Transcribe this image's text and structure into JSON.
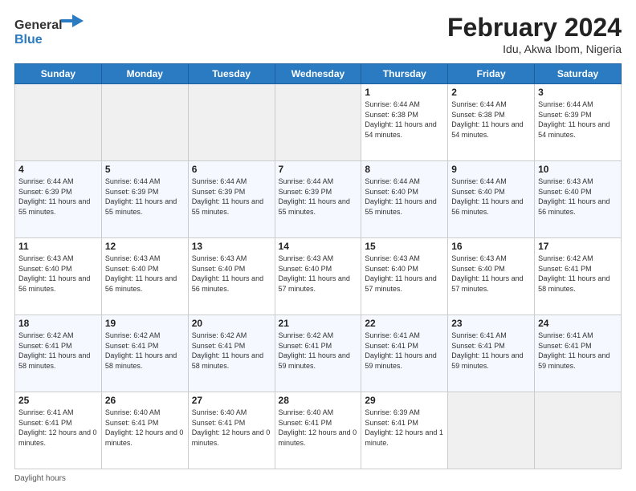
{
  "header": {
    "logo_general": "General",
    "logo_blue": "Blue",
    "month_year": "February 2024",
    "location": "Idu, Akwa Ibom, Nigeria"
  },
  "weekdays": [
    "Sunday",
    "Monday",
    "Tuesday",
    "Wednesday",
    "Thursday",
    "Friday",
    "Saturday"
  ],
  "weeks": [
    [
      {
        "day": "",
        "empty": true
      },
      {
        "day": "",
        "empty": true
      },
      {
        "day": "",
        "empty": true
      },
      {
        "day": "",
        "empty": true
      },
      {
        "day": "1",
        "sunrise": "6:44 AM",
        "sunset": "6:38 PM",
        "daylight": "11 hours and 54 minutes."
      },
      {
        "day": "2",
        "sunrise": "6:44 AM",
        "sunset": "6:38 PM",
        "daylight": "11 hours and 54 minutes."
      },
      {
        "day": "3",
        "sunrise": "6:44 AM",
        "sunset": "6:39 PM",
        "daylight": "11 hours and 54 minutes."
      }
    ],
    [
      {
        "day": "4",
        "sunrise": "6:44 AM",
        "sunset": "6:39 PM",
        "daylight": "11 hours and 55 minutes."
      },
      {
        "day": "5",
        "sunrise": "6:44 AM",
        "sunset": "6:39 PM",
        "daylight": "11 hours and 55 minutes."
      },
      {
        "day": "6",
        "sunrise": "6:44 AM",
        "sunset": "6:39 PM",
        "daylight": "11 hours and 55 minutes."
      },
      {
        "day": "7",
        "sunrise": "6:44 AM",
        "sunset": "6:39 PM",
        "daylight": "11 hours and 55 minutes."
      },
      {
        "day": "8",
        "sunrise": "6:44 AM",
        "sunset": "6:40 PM",
        "daylight": "11 hours and 55 minutes."
      },
      {
        "day": "9",
        "sunrise": "6:44 AM",
        "sunset": "6:40 PM",
        "daylight": "11 hours and 56 minutes."
      },
      {
        "day": "10",
        "sunrise": "6:43 AM",
        "sunset": "6:40 PM",
        "daylight": "11 hours and 56 minutes."
      }
    ],
    [
      {
        "day": "11",
        "sunrise": "6:43 AM",
        "sunset": "6:40 PM",
        "daylight": "11 hours and 56 minutes."
      },
      {
        "day": "12",
        "sunrise": "6:43 AM",
        "sunset": "6:40 PM",
        "daylight": "11 hours and 56 minutes."
      },
      {
        "day": "13",
        "sunrise": "6:43 AM",
        "sunset": "6:40 PM",
        "daylight": "11 hours and 56 minutes."
      },
      {
        "day": "14",
        "sunrise": "6:43 AM",
        "sunset": "6:40 PM",
        "daylight": "11 hours and 57 minutes."
      },
      {
        "day": "15",
        "sunrise": "6:43 AM",
        "sunset": "6:40 PM",
        "daylight": "11 hours and 57 minutes."
      },
      {
        "day": "16",
        "sunrise": "6:43 AM",
        "sunset": "6:40 PM",
        "daylight": "11 hours and 57 minutes."
      },
      {
        "day": "17",
        "sunrise": "6:42 AM",
        "sunset": "6:41 PM",
        "daylight": "11 hours and 58 minutes."
      }
    ],
    [
      {
        "day": "18",
        "sunrise": "6:42 AM",
        "sunset": "6:41 PM",
        "daylight": "11 hours and 58 minutes."
      },
      {
        "day": "19",
        "sunrise": "6:42 AM",
        "sunset": "6:41 PM",
        "daylight": "11 hours and 58 minutes."
      },
      {
        "day": "20",
        "sunrise": "6:42 AM",
        "sunset": "6:41 PM",
        "daylight": "11 hours and 58 minutes."
      },
      {
        "day": "21",
        "sunrise": "6:42 AM",
        "sunset": "6:41 PM",
        "daylight": "11 hours and 59 minutes."
      },
      {
        "day": "22",
        "sunrise": "6:41 AM",
        "sunset": "6:41 PM",
        "daylight": "11 hours and 59 minutes."
      },
      {
        "day": "23",
        "sunrise": "6:41 AM",
        "sunset": "6:41 PM",
        "daylight": "11 hours and 59 minutes."
      },
      {
        "day": "24",
        "sunrise": "6:41 AM",
        "sunset": "6:41 PM",
        "daylight": "11 hours and 59 minutes."
      }
    ],
    [
      {
        "day": "25",
        "sunrise": "6:41 AM",
        "sunset": "6:41 PM",
        "daylight": "12 hours and 0 minutes."
      },
      {
        "day": "26",
        "sunrise": "6:40 AM",
        "sunset": "6:41 PM",
        "daylight": "12 hours and 0 minutes."
      },
      {
        "day": "27",
        "sunrise": "6:40 AM",
        "sunset": "6:41 PM",
        "daylight": "12 hours and 0 minutes."
      },
      {
        "day": "28",
        "sunrise": "6:40 AM",
        "sunset": "6:41 PM",
        "daylight": "12 hours and 0 minutes."
      },
      {
        "day": "29",
        "sunrise": "6:39 AM",
        "sunset": "6:41 PM",
        "daylight": "12 hours and 1 minute."
      },
      {
        "day": "",
        "empty": true
      },
      {
        "day": "",
        "empty": true
      }
    ]
  ],
  "legend": {
    "daylight_label": "Daylight hours"
  }
}
